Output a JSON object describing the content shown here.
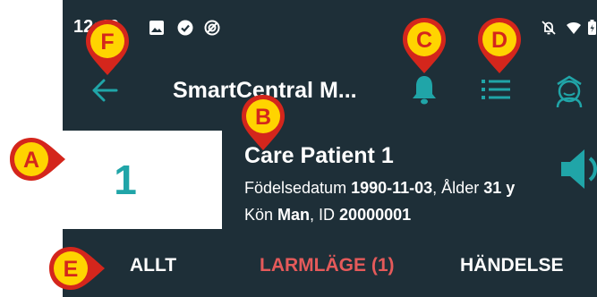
{
  "status_bar": {
    "time": "12:49",
    "left_icons": [
      "image-icon",
      "check-circle-icon",
      "sync-circle-icon"
    ],
    "right_icons": [
      "bell-off-icon",
      "wifi-icon",
      "battery-icon"
    ]
  },
  "app_bar": {
    "title": "SmartCentral M...",
    "icons": [
      "back-arrow-icon",
      "bell-icon",
      "list-icon",
      "nurse-avatar-icon"
    ]
  },
  "patient": {
    "bed_number": "1",
    "name": "Care Patient 1",
    "dob_label": "Födelsedatum ",
    "dob": "1990-11-03",
    "age_label": ", Ålder ",
    "age": "31 y",
    "sex_label": "Kön ",
    "sex": "Man",
    "id_label": ", ID ",
    "id": "20000001"
  },
  "tabs": [
    {
      "label": "ALLT",
      "active": false
    },
    {
      "label": "LARMLÄGE (1)",
      "active": true
    },
    {
      "label": "HÄNDELSE",
      "active": false
    }
  ],
  "callouts": [
    "A",
    "B",
    "C",
    "D",
    "E",
    "F"
  ],
  "colors": {
    "background": "#1e2f38",
    "accent_teal": "#20a5a8",
    "alarm_red": "#e55a5a",
    "callout_red": "#d4261c",
    "callout_yellow": "#ffd400",
    "text": "#ffffff"
  }
}
